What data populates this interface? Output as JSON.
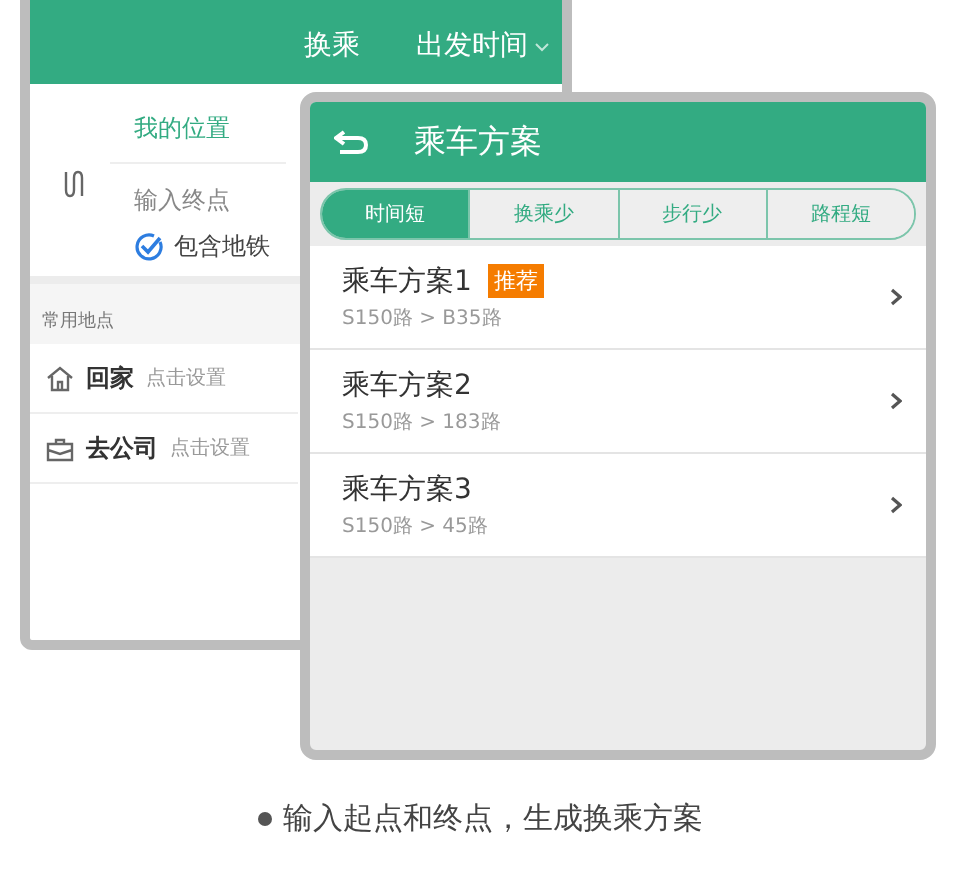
{
  "back_screen": {
    "header": {
      "mode": "换乘",
      "time_selector": "出发时间"
    },
    "start": "我的位置",
    "end_placeholder": "输入终点",
    "include_subway": {
      "label": "包含地铁",
      "checked": true
    },
    "favorites_title": "常用地点",
    "places": [
      {
        "kind": "home",
        "label": "回家",
        "hint": "点击设置"
      },
      {
        "kind": "office",
        "label": "去公司",
        "hint": "点击设置"
      }
    ]
  },
  "front_screen": {
    "title": "乘车方案",
    "tabs": [
      {
        "label": "时间短",
        "selected": true
      },
      {
        "label": "换乘少",
        "selected": false
      },
      {
        "label": "步行少",
        "selected": false
      },
      {
        "label": "路程短",
        "selected": false
      }
    ],
    "plans": [
      {
        "name": "乘车方案1",
        "badge": "推荐",
        "route": "S150路 > B35路"
      },
      {
        "name": "乘车方案2",
        "route": "S150路 > 183路"
      },
      {
        "name": "乘车方案3",
        "route": "S150路 > 45路"
      }
    ]
  },
  "caption": "输入起点和终点，生成换乘方案"
}
